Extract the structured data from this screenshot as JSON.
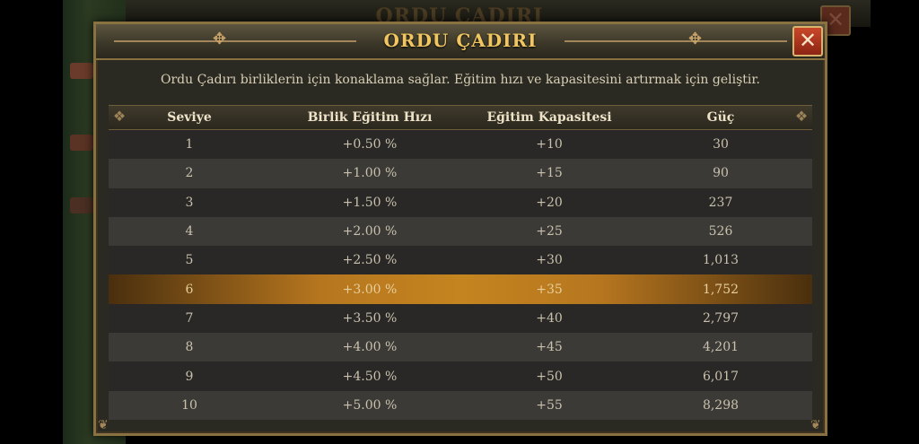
{
  "window": {
    "title": "ORDU ÇADIRI",
    "close_glyph": "✕",
    "description": "Ordu Çadırı birliklerin için konaklama sağlar. Eğitim hızı ve kapasitesini artırmak için geliştir."
  },
  "table": {
    "headers": [
      "Seviye",
      "Birlik Eğitim Hızı",
      "Eğitim Kapasitesi",
      "Güç"
    ],
    "current_level": "6",
    "rows": [
      [
        "1",
        "+0.50 %",
        "+10",
        "30"
      ],
      [
        "2",
        "+1.00 %",
        "+15",
        "90"
      ],
      [
        "3",
        "+1.50 %",
        "+20",
        "237"
      ],
      [
        "4",
        "+2.00 %",
        "+25",
        "526"
      ],
      [
        "5",
        "+2.50 %",
        "+30",
        "1,013"
      ],
      [
        "6",
        "+3.00 %",
        "+35",
        "1,752"
      ],
      [
        "7",
        "+3.50 %",
        "+40",
        "2,797"
      ],
      [
        "8",
        "+4.00 %",
        "+45",
        "4,201"
      ],
      [
        "9",
        "+4.50 %",
        "+50",
        "6,017"
      ],
      [
        "10",
        "+5.00 %",
        "+55",
        "8,298"
      ]
    ]
  },
  "colors": {
    "title": "#f1c661",
    "frame": "#8a7141",
    "highlight": "#c4841f",
    "close_button": "#c9472a"
  },
  "icons": {
    "close": "close-icon",
    "flourish": "flourish-icon"
  }
}
